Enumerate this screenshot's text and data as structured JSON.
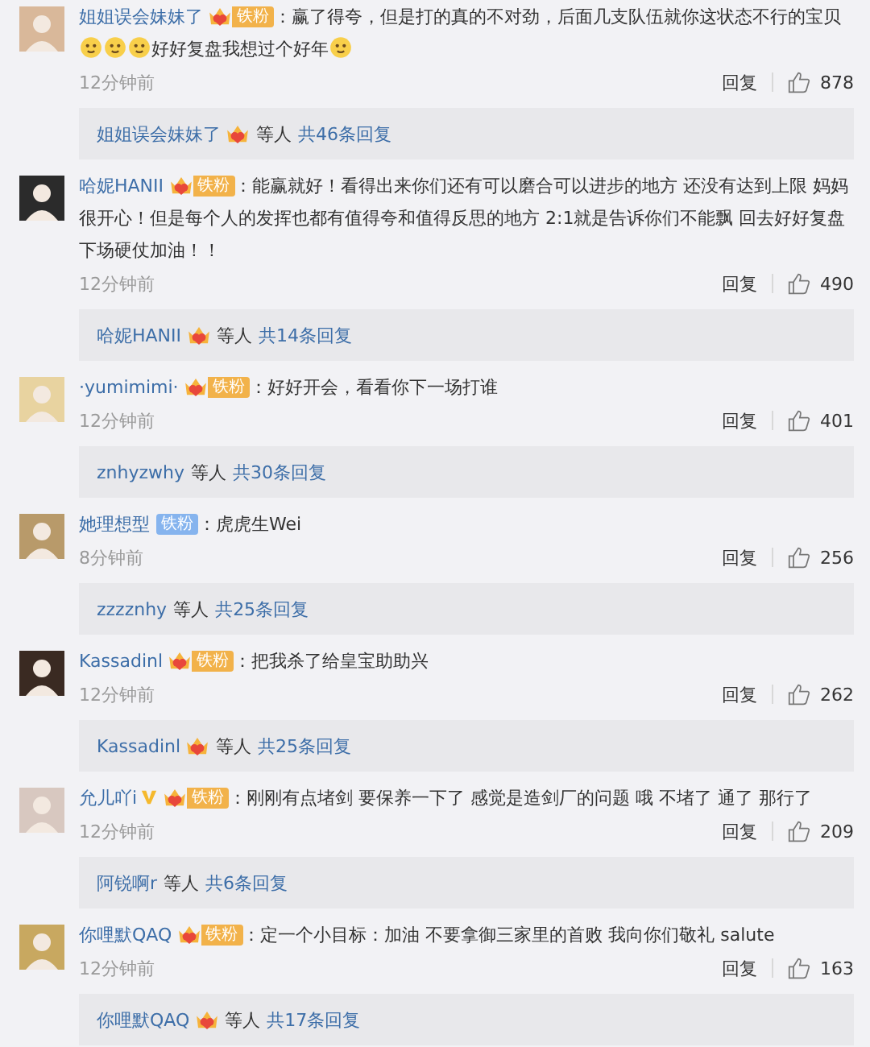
{
  "comments": [
    {
      "user": "姐姐误会妹妹了",
      "verified": false,
      "badge": {
        "kind": "crown",
        "label": "铁粉"
      },
      "colon": "：",
      "parts": [
        {
          "kind": "text",
          "text": "赢了得夸，但是打的真的不对劲，后面几支队伍就你这状态不行的宝贝"
        },
        {
          "kind": "emoji"
        },
        {
          "kind": "emoji"
        },
        {
          "kind": "emoji"
        },
        {
          "kind": "text",
          "text": "好好复盘我想过个好年"
        },
        {
          "kind": "emoji"
        }
      ],
      "time": "12分钟前",
      "reply": "回复",
      "likes": "878",
      "summary": {
        "name": "姐姐误会妹妹了",
        "crown": true,
        "suffix": "等人",
        "count": "共46条回复"
      }
    },
    {
      "user": "哈妮HANII",
      "verified": false,
      "badge": {
        "kind": "crown",
        "label": "铁粉"
      },
      "colon": "：",
      "parts": [
        {
          "kind": "text",
          "text": "能赢就好！看得出来你们还有可以磨合可以进步的地方 还没有达到上限 妈妈很开心！但是每个人的发挥也都有值得夸和值得反思的地方 2:1就是告诉你们不能飘 回去好好复盘下场硬仗加油！！"
        }
      ],
      "time": "12分钟前",
      "reply": "回复",
      "likes": "490",
      "summary": {
        "name": "哈妮HANII",
        "crown": true,
        "suffix": "等人",
        "count": "共14条回复"
      }
    },
    {
      "user": "·yumimimi·",
      "verified": false,
      "badge": {
        "kind": "crown",
        "label": "铁粉"
      },
      "colon": "：",
      "parts": [
        {
          "kind": "text",
          "text": "好好开会，看看你下一场打谁"
        }
      ],
      "time": "12分钟前",
      "reply": "回复",
      "likes": "401",
      "summary": {
        "name": "znhyzwhy",
        "crown": false,
        "suffix": "等人",
        "count": "共30条回复"
      }
    },
    {
      "user": "她理想型",
      "verified": false,
      "badge": {
        "kind": "plain",
        "label": "铁粉"
      },
      "colon": "：",
      "parts": [
        {
          "kind": "text",
          "text": "虎虎生Wei"
        }
      ],
      "time": "8分钟前",
      "reply": "回复",
      "likes": "256",
      "summary": {
        "name": "zzzznhy",
        "crown": false,
        "suffix": "等人",
        "count": "共25条回复"
      }
    },
    {
      "user": "Kassadinl",
      "verified": false,
      "badge": {
        "kind": "crown",
        "label": "铁粉"
      },
      "colon": "：",
      "parts": [
        {
          "kind": "text",
          "text": "把我杀了给皇宝助助兴"
        }
      ],
      "time": "12分钟前",
      "reply": "回复",
      "likes": "262",
      "summary": {
        "name": "Kassadinl",
        "crown": true,
        "suffix": "等人",
        "count": "共25条回复"
      }
    },
    {
      "user": "允儿吖i",
      "verified": true,
      "badge": {
        "kind": "crown",
        "label": "铁粉"
      },
      "colon": "：",
      "parts": [
        {
          "kind": "text",
          "text": "刚刚有点堵剑 要保养一下了 感觉是造剑厂的问题 哦 不堵了 通了 那行了"
        }
      ],
      "time": "12分钟前",
      "reply": "回复",
      "likes": "209",
      "summary": {
        "name": "阿锐啊r",
        "crown": false,
        "suffix": "等人",
        "count": "共6条回复"
      }
    },
    {
      "user": "你哩默QAQ",
      "verified": false,
      "badge": {
        "kind": "crown",
        "label": "铁粉"
      },
      "colon": "：",
      "parts": [
        {
          "kind": "text",
          "text": "定一个小目标：加油 不要拿御三家里的首败 我向你们敬礼 salute"
        }
      ],
      "time": "12分钟前",
      "reply": "回复",
      "likes": "163",
      "summary": {
        "name": "你哩默QAQ",
        "crown": true,
        "suffix": "等人",
        "count": "共17条回复"
      }
    }
  ]
}
